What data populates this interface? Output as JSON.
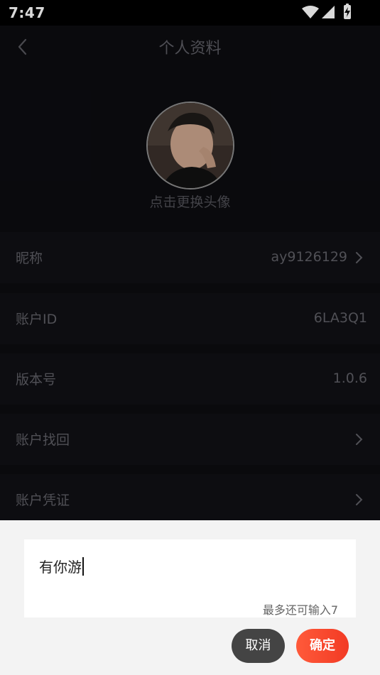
{
  "status_bar": {
    "time": "7:47"
  },
  "header": {
    "title": "个人资料"
  },
  "avatar": {
    "hint": "点击更换头像"
  },
  "rows": [
    {
      "label": "昵称",
      "value": "ay9126129"
    },
    {
      "label": "账户ID",
      "value": "6LA3Q1"
    },
    {
      "label": "版本号",
      "value": "1.0.6"
    },
    {
      "label": "账户找回",
      "value": ""
    },
    {
      "label": "账户凭证",
      "value": ""
    }
  ],
  "dialog": {
    "input_value": "有你游",
    "counter": "最多还可输入7",
    "cancel_label": "取消",
    "confirm_label": "确定"
  },
  "colors": {
    "confirm_accent": "#f23a24",
    "background": "#0c0c10"
  }
}
